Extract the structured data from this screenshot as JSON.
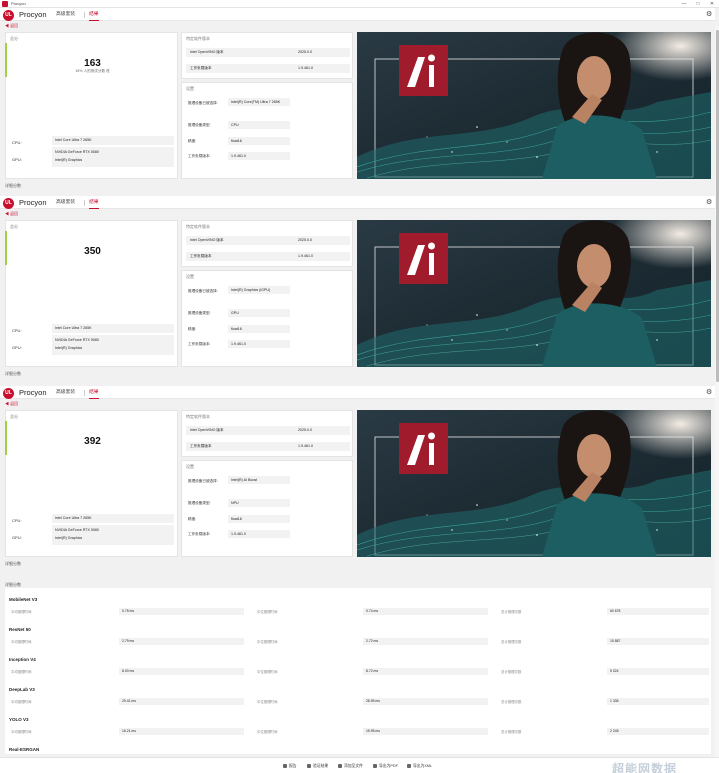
{
  "titlebar": {
    "title": "Procyon",
    "controls": [
      "—",
      "□",
      "✕"
    ]
  },
  "brand": {
    "logo_text": "UL",
    "name": "Procyon"
  },
  "nav": {
    "tab1": "高级套装",
    "tab2": "结果"
  },
  "back_label": "◀ 返回",
  "score_label": "总分",
  "info_title": "特定软件版本",
  "settings_title": "设置",
  "hardware": {
    "cpu_label": "CPU:",
    "gpu_label": "GPU:",
    "cpu": "Intel Core Ultra 7 265K",
    "gpu1": "NVIDIA GeForce RTX 5080",
    "gpu2": "Intel(R) Graphics"
  },
  "info_rows": [
    {
      "k": "Intel OpenVINO 版本",
      "v": "2025.0.0"
    },
    {
      "k": "工作负载版本",
      "v": "1.9.461.0"
    }
  ],
  "detail_label": "详细分数",
  "sections": [
    {
      "score": "163",
      "sub": "15% 人的测试分数 低",
      "settings": [
        {
          "k": "推理设备已被选择:",
          "v": "Intel(R) Core(TM) Ultra 7 265K"
        },
        {
          "k": "推理设备类型:",
          "v": "CPU"
        },
        {
          "k": "精度:",
          "v": "float16"
        },
        {
          "k": "工作负载版本:",
          "v": "1.9.461.0"
        }
      ]
    },
    {
      "score": "350",
      "sub": "",
      "settings": [
        {
          "k": "推理设备已被选择:",
          "v": "Intel(R) Graphics (iGPU)"
        },
        {
          "k": "推理设备类型:",
          "v": "GPU"
        },
        {
          "k": "精度:",
          "v": "float16"
        },
        {
          "k": "工作负载版本:",
          "v": "1.9.461.0"
        }
      ]
    },
    {
      "score": "392",
      "sub": "",
      "settings": [
        {
          "k": "推理设备已被选择:",
          "v": "Intel(R) AI Boost"
        },
        {
          "k": "推理设备类型:",
          "v": "NPU"
        },
        {
          "k": "精度:",
          "v": "float16"
        },
        {
          "k": "工作负载版本:",
          "v": "1.9.461.0"
        }
      ]
    }
  ],
  "metrics": {
    "m1": "平均推理时间",
    "m2": "中位推理时间",
    "m3": "总计推理次数"
  },
  "benchmarks": [
    {
      "name": "MobileNet V3",
      "avg": "0.75 ms",
      "median": "0.74 ms",
      "count": "60 678"
    },
    {
      "name": "ResNet 50",
      "avg": "2.79 ms",
      "median": "2.72 ms",
      "count": "15 887"
    },
    {
      "name": "Inception V4",
      "avg": "8.00 ms",
      "median": "8.72 ms",
      "count": "5 024"
    },
    {
      "name": "DeepLab V3",
      "avg": "29.41 ms",
      "median": "28.95 ms",
      "count": "1 335"
    },
    {
      "name": "YOLO V3",
      "avg": "16.21 ms",
      "median": "15.95 ms",
      "count": "2 245"
    },
    {
      "name": "Real-ESRGAN",
      "avg": "",
      "median": "",
      "count": ""
    }
  ],
  "bottombar": {
    "b1": "报告",
    "b2": "验证结果",
    "b3": "添加至文件",
    "b4": "导出为PDF",
    "b5": "导出为XML"
  },
  "watermark": "超能网数据",
  "colors": {
    "brand_red": "#c8102e",
    "score_accent": "#9fd047",
    "hero_logo": "#a01c2c"
  }
}
